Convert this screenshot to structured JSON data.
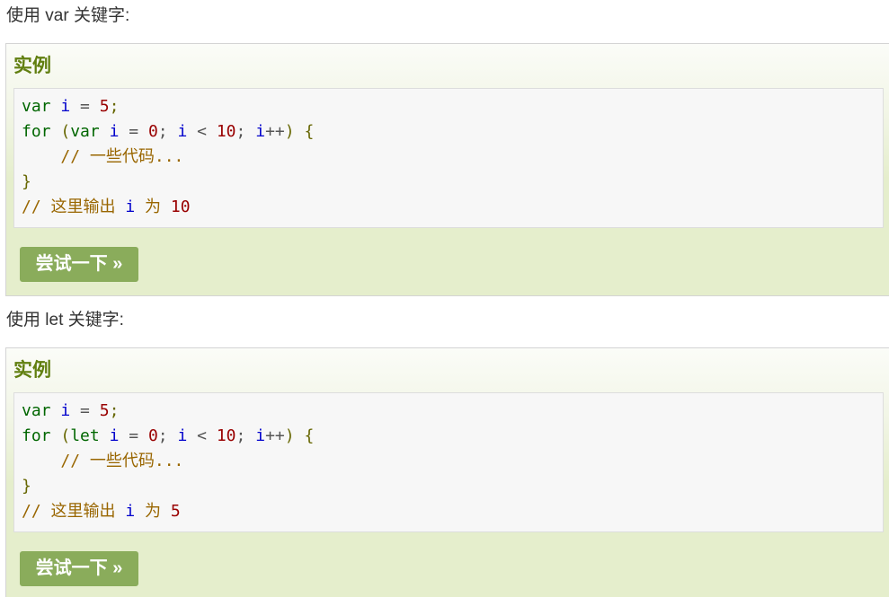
{
  "sections": [
    {
      "intro": "使用 var 关键字:",
      "heading": "实例",
      "code": {
        "line1": {
          "kw": "var",
          "var": "i",
          "op": "=",
          "num": "5",
          "pn": ";"
        },
        "line2": {
          "kw_for": "for",
          "open": "(",
          "kw_decl": "var",
          "var1": "i",
          "eq": "=",
          "zero": "0",
          "semi1": ";",
          "var2": "i",
          "lt": "<",
          "ten": "10",
          "semi2": ";",
          "var3": "i",
          "inc": "++",
          "close": ")",
          "brace": "{"
        },
        "line3": {
          "comment": "// 一些代码..."
        },
        "line4": {
          "brace": "}"
        },
        "line5": {
          "comment_prefix": "// 这里输出",
          "var": "i",
          "comment_mid": "为",
          "num": "10"
        }
      },
      "button": "尝试一下 »"
    },
    {
      "intro": "使用 let 关键字:",
      "heading": "实例",
      "code": {
        "line1": {
          "kw": "var",
          "var": "i",
          "op": "=",
          "num": "5",
          "pn": ";"
        },
        "line2": {
          "kw_for": "for",
          "open": "(",
          "kw_decl": "let",
          "var1": "i",
          "eq": "=",
          "zero": "0",
          "semi1": ";",
          "var2": "i",
          "lt": "<",
          "ten": "10",
          "semi2": ";",
          "var3": "i",
          "inc": "++",
          "close": ")",
          "brace": "{"
        },
        "line3": {
          "comment": "// 一些代码..."
        },
        "line4": {
          "brace": "}"
        },
        "line5": {
          "comment_prefix": "// 这里输出",
          "var": "i",
          "comment_mid": "为",
          "num": "5"
        }
      },
      "button": "尝试一下 »"
    }
  ],
  "colors": {
    "heading": "#617f10",
    "button_bg": "#8aac5b",
    "keyword": "#006600",
    "identifier": "#0000cc",
    "number": "#990000",
    "comment": "#996600",
    "example_bg": "#e5eecc"
  }
}
